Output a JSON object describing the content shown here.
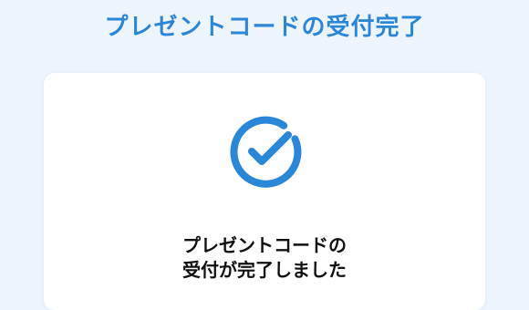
{
  "header": {
    "title": "プレゼントコードの受付完了"
  },
  "card": {
    "icon": "check-circle-icon",
    "message_line1": "プレゼントコードの",
    "message_line2": "受付が完了しました"
  },
  "colors": {
    "accent": "#2a86d8",
    "background": "#edf4fc",
    "card": "#ffffff",
    "text": "#111111"
  }
}
